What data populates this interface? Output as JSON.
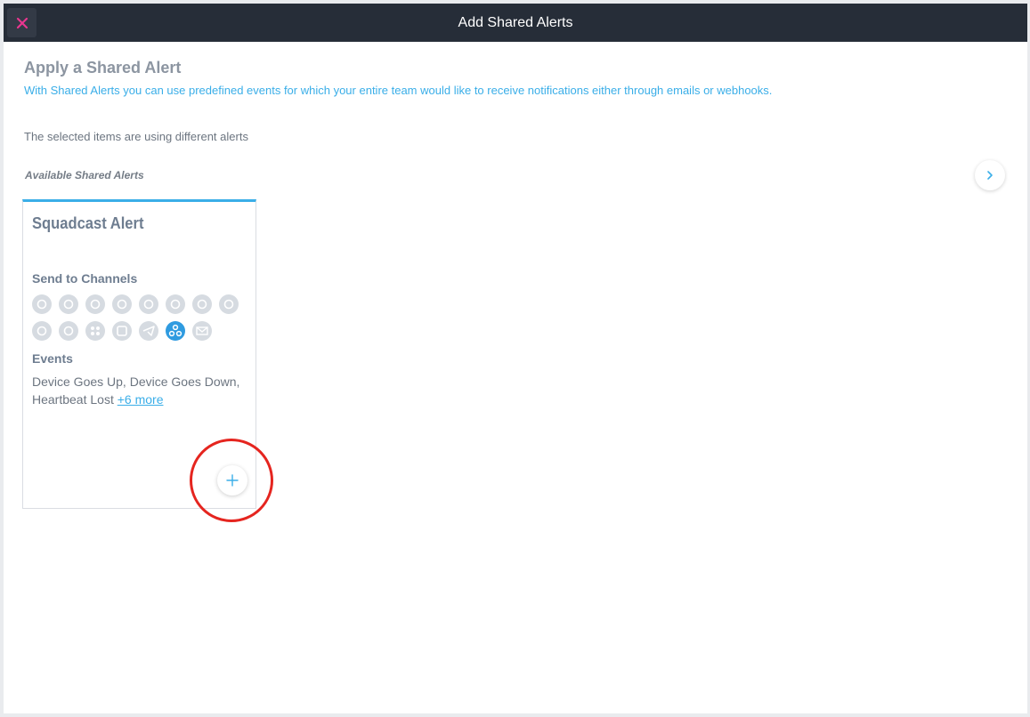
{
  "modal": {
    "title": "Add Shared Alerts",
    "close_icon": "close-x-icon"
  },
  "header": {
    "heading": "Apply a Shared Alert",
    "subtitle": "With Shared Alerts you can use predefined events for which your entire team would like to receive notifications either through emails or webhooks."
  },
  "notice": "The selected items are using different alerts",
  "available_label": "Available Shared Alerts",
  "next_icon": "chevron-right-icon",
  "card": {
    "title": "Squadcast Alert",
    "channels_label": "Send to Channels",
    "channels": [
      {
        "name": "channel-1-icon",
        "active": false
      },
      {
        "name": "channel-2-icon",
        "active": false
      },
      {
        "name": "channel-3-icon",
        "active": false
      },
      {
        "name": "channel-4-icon",
        "active": false
      },
      {
        "name": "channel-5-icon",
        "active": false
      },
      {
        "name": "channel-6-icon",
        "active": false
      },
      {
        "name": "channel-7-icon",
        "active": false
      },
      {
        "name": "channel-8-icon",
        "active": false
      },
      {
        "name": "channel-9-icon",
        "active": false
      },
      {
        "name": "channel-10-icon",
        "active": false
      },
      {
        "name": "slack-icon",
        "active": false
      },
      {
        "name": "teams-icon",
        "active": false
      },
      {
        "name": "telegram-icon",
        "active": false
      },
      {
        "name": "webhook-icon",
        "active": true
      },
      {
        "name": "email-icon",
        "active": false
      }
    ],
    "events_label": "Events",
    "events_text": "Device Goes Up, Device Goes Down, Heartbeat Lost",
    "more_link": "+6 more",
    "add_icon": "plus-icon"
  },
  "colors": {
    "accent": "#3aaee8",
    "titlebar": "#262d38",
    "close": "#e8368f",
    "highlight": "#e5251f",
    "channel_active": "#2f9be0",
    "channel_inactive": "#d6dbe1"
  }
}
